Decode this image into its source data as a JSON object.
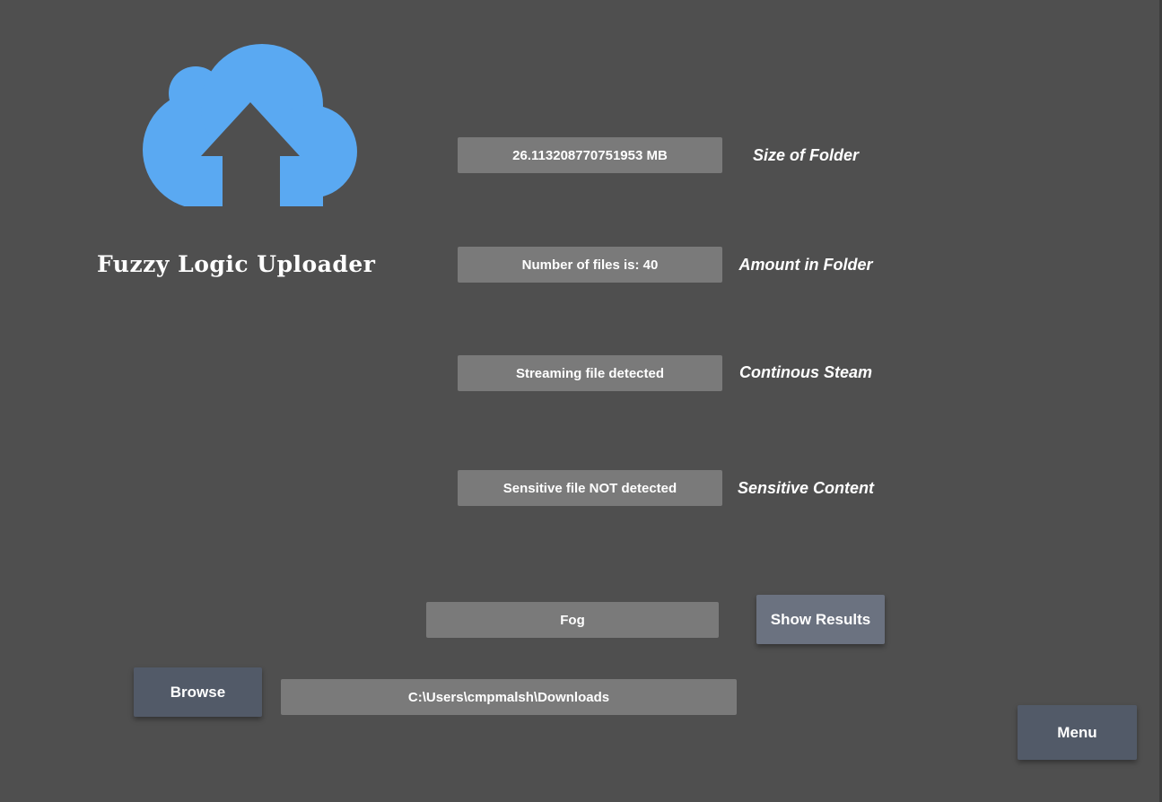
{
  "app": {
    "title": "Fuzzy Logic Uploader",
    "logo_icon": "cloud-upload-icon",
    "logo_color": "#5aa9f2",
    "background_color": "#4f4f4f"
  },
  "metrics": {
    "size": {
      "value": "26.113208770751953 MB",
      "label": "Size of Folder"
    },
    "count": {
      "value": "Number of files is: 40",
      "label": "Amount in Folder"
    },
    "stream": {
      "value": "Streaming file detected",
      "label": "Continous Steam"
    },
    "sensitive": {
      "value": "Sensitive file NOT detected",
      "label": "Sensitive Content"
    }
  },
  "result": {
    "value": "Fog",
    "show_results_label": "Show Results"
  },
  "browse": {
    "button_label": "Browse",
    "path": "C:\\Users\\cmpmalsh\\Downloads"
  },
  "menu": {
    "label": "Menu"
  }
}
